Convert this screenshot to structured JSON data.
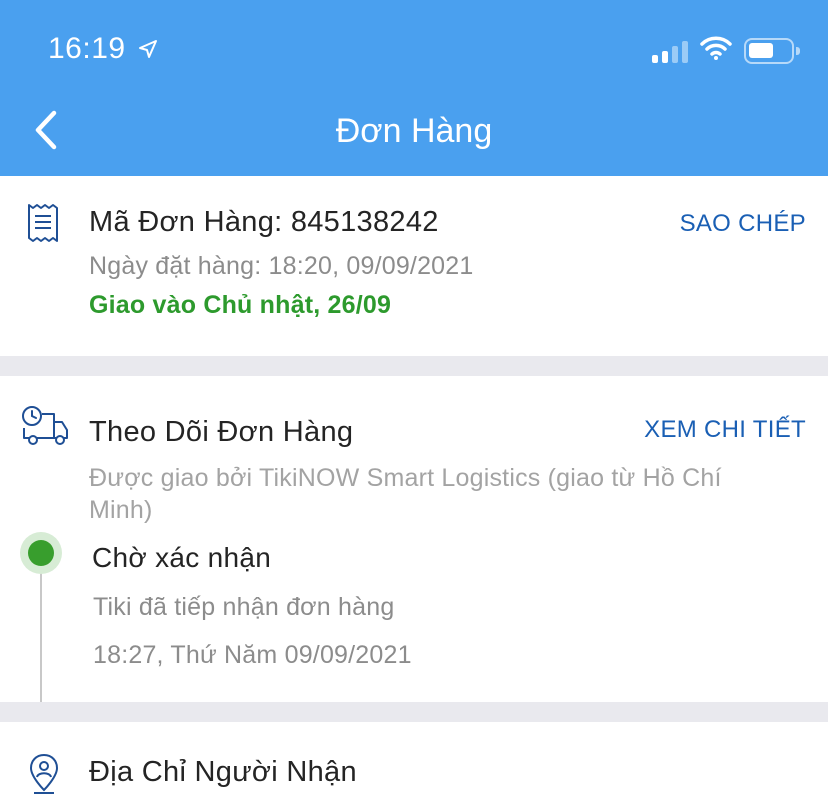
{
  "status_bar": {
    "time": "16:19",
    "icons": [
      "location-arrow-icon",
      "signal-icon",
      "wifi-icon",
      "battery-icon"
    ]
  },
  "nav": {
    "title": "Đơn Hàng",
    "back_icon": "chevron-left-icon"
  },
  "order": {
    "id_label": "Mã Đơn Hàng: 845138242",
    "placed_at": "Ngày đặt hàng: 18:20, 09/09/2021",
    "delivery_estimate": "Giao vào Chủ nhật, 26/09",
    "copy_label": "SAO CHÉP",
    "icon": "receipt-icon"
  },
  "tracking": {
    "title": "Theo Dõi Đơn Hàng",
    "detail_label": "XEM CHI TIẾT",
    "carrier": "Được giao bởi TikiNOW Smart Logistics (giao từ Hồ Chí Minh)",
    "icon": "delivery-truck-icon",
    "steps": [
      {
        "status": "Chờ xác nhận",
        "description": "Tiki đã tiếp nhận đơn hàng",
        "time": "18:27, Thứ Năm 09/09/2021"
      }
    ]
  },
  "recipient": {
    "title": "Địa Chỉ Người Nhận",
    "icon": "location-person-icon"
  },
  "colors": {
    "header": "#4aa0ef",
    "accent_link": "#1a5fb4",
    "success": "#2d9a2d",
    "icon_blue": "#1f4f95"
  }
}
